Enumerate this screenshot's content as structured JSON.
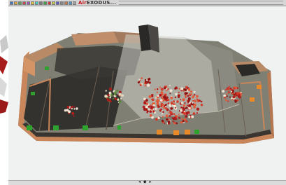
{
  "app": {
    "title_brand": "Air",
    "title_main": "EXODUS",
    "title_suffix": "..."
  },
  "toolbar": {
    "icons": [
      {
        "name": "new-icon",
        "color": "#4a79c9"
      },
      {
        "name": "open-icon",
        "color": "#d9a441"
      },
      {
        "name": "save-icon",
        "color": "#5aa45a"
      },
      {
        "name": "print-icon",
        "color": "#c94a4a"
      },
      {
        "name": "cut-icon",
        "color": "#9b59b6"
      },
      {
        "name": "copy-icon",
        "color": "#e0c341"
      },
      {
        "name": "paste-icon",
        "color": "#4ac9c1"
      },
      {
        "name": "zoom-icon",
        "color": "#7a7a7a"
      },
      {
        "name": "run-icon",
        "color": "#3aa83a"
      },
      {
        "name": "stop-icon",
        "color": "#d23a3a"
      },
      {
        "name": "pause-icon",
        "color": "#c9c94a"
      },
      {
        "name": "camera-icon",
        "color": "#5a5ac9"
      },
      {
        "name": "grid-icon",
        "color": "#8a8a8a"
      },
      {
        "name": "layer-icon",
        "color": "#c97a4a"
      },
      {
        "name": "graph-icon",
        "color": "#4a9ac9"
      },
      {
        "name": "help-icon",
        "color": "#aaaaaa"
      }
    ]
  },
  "navigation": {
    "arrows_label": "◂ ◆ ▸"
  },
  "colors": {
    "floor": "#8a8a7c",
    "wall": "#c8865a",
    "wall_dark": "#2b2a26",
    "agent_red": "#b01c1c",
    "exit_green": "#2fa12f",
    "exit_orange": "#e8892a",
    "sky": "#eff2f1"
  }
}
